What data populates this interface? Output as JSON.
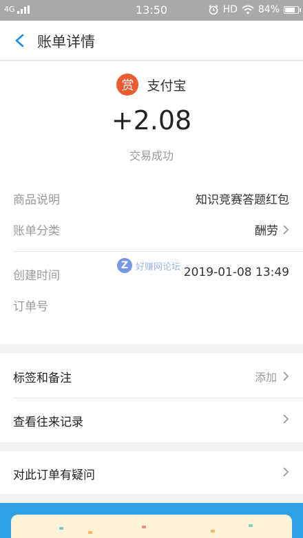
{
  "status_bar": {
    "network": "4G",
    "time": "13:50",
    "hd": "HD",
    "battery": "84%",
    "battery_level": 0.84
  },
  "header": {
    "back_icon": "chevron-left-icon",
    "title": "账单详情"
  },
  "transaction": {
    "merchant_icon_char": "赏",
    "merchant_name": "支付宝",
    "amount": "+2.08",
    "status": "交易成功"
  },
  "details": {
    "product_label": "商品说明",
    "product_value": "知识竞赛答题红包",
    "category_label": "账单分类",
    "category_value": "酬劳",
    "created_label": "创建时间",
    "created_value": "2019-01-08 13:49",
    "order_label": "订单号",
    "order_value": ""
  },
  "watermark": {
    "badge": "Z",
    "text": "好赚网论坛"
  },
  "actions": {
    "tags_label": "标签和备注",
    "tags_action": "添加",
    "history_label": "查看往来记录",
    "question_label": "对此订单有疑问"
  },
  "colors": {
    "accent": "#1a8ce6",
    "merchant_icon": "#ec5b2f",
    "banner": "#2f9fe6"
  }
}
